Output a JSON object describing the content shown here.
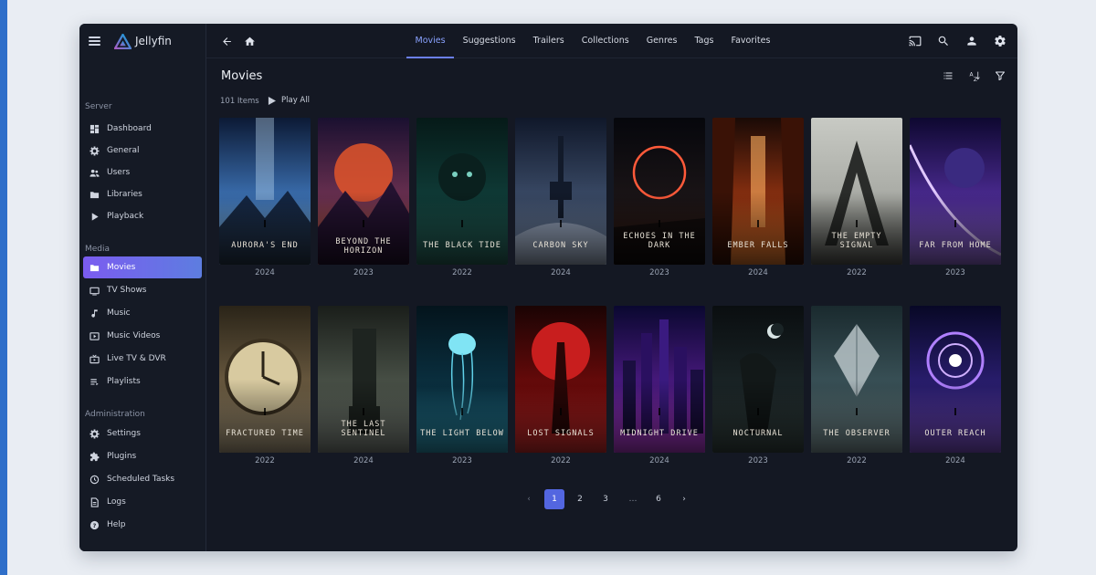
{
  "app": {
    "name": "Jellyfin"
  },
  "sidebar": {
    "sections": [
      {
        "title": "Server",
        "items": [
          {
            "label": "Dashboard",
            "icon": "dashboard-icon"
          },
          {
            "label": "General",
            "icon": "gear-icon"
          },
          {
            "label": "Users",
            "icon": "users-icon"
          },
          {
            "label": "Libraries",
            "icon": "folder-icon"
          },
          {
            "label": "Playback",
            "icon": "play-icon"
          }
        ]
      },
      {
        "title": "Media",
        "items": [
          {
            "label": "Movies",
            "icon": "folder-icon",
            "active": true
          },
          {
            "label": "TV Shows",
            "icon": "tv-icon"
          },
          {
            "label": "Music",
            "icon": "music-note-icon"
          },
          {
            "label": "Music Videos",
            "icon": "music-video-icon"
          },
          {
            "label": "Live TV & DVR",
            "icon": "live-tv-icon"
          },
          {
            "label": "Playlists",
            "icon": "playlist-icon"
          }
        ]
      },
      {
        "title": "Administration",
        "items": [
          {
            "label": "Settings",
            "icon": "gear-icon"
          },
          {
            "label": "Plugins",
            "icon": "puzzle-icon"
          },
          {
            "label": "Scheduled Tasks",
            "icon": "clock-icon"
          },
          {
            "label": "Logs",
            "icon": "document-icon"
          },
          {
            "label": "Help",
            "icon": "help-icon"
          }
        ]
      }
    ]
  },
  "tabs": [
    "Movies",
    "Suggestions",
    "Trailers",
    "Collections",
    "Genres",
    "Tags",
    "Favorites"
  ],
  "active_tab": "Movies",
  "page": {
    "title": "Movies",
    "item_count": "101 Items",
    "play_all": "Play All"
  },
  "movies": [
    {
      "title": "AURORA'S END",
      "year": "2024"
    },
    {
      "title": "BEYOND THE HORIZON",
      "year": "2023"
    },
    {
      "title": "THE BLACK TIDE",
      "year": "2022"
    },
    {
      "title": "CARBON SKY",
      "year": "2024"
    },
    {
      "title": "ECHOES IN THE DARK",
      "year": "2023"
    },
    {
      "title": "EMBER FALLS",
      "year": "2024"
    },
    {
      "title": "THE EMPTY SIGNAL",
      "year": "2022"
    },
    {
      "title": "FAR FROM HOME",
      "year": "2023"
    },
    {
      "title": "FRACTURED TIME",
      "year": "2022"
    },
    {
      "title": "THE LAST SENTINEL",
      "year": "2024"
    },
    {
      "title": "THE LIGHT BELOW",
      "year": "2023"
    },
    {
      "title": "LOST SIGNALS",
      "year": "2022"
    },
    {
      "title": "MIDNIGHT DRIVE",
      "year": "2024"
    },
    {
      "title": "NOCTURNAL",
      "year": "2023"
    },
    {
      "title": "THE OBSERVER",
      "year": "2022"
    },
    {
      "title": "OUTER REACH",
      "year": "2024"
    }
  ],
  "pagination": {
    "prev": "‹",
    "pages": [
      "1",
      "2",
      "3",
      "…",
      "6"
    ],
    "current": "1",
    "next": "›"
  },
  "colors": {
    "accent": "#6b7ff0",
    "active_nav_start": "#7b5cf0",
    "active_nav_end": "#5d7de0",
    "window_bg": "#141823"
  }
}
